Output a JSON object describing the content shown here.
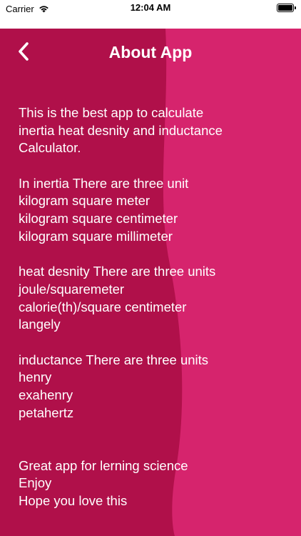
{
  "status_bar": {
    "carrier": "Carrier",
    "time": "12:04 AM"
  },
  "nav": {
    "title": "About App",
    "back_icon": "chevron-left-icon"
  },
  "colors": {
    "background": "#d6246d",
    "wave": "#b0104a",
    "text": "#ffffff"
  },
  "about": {
    "lines": [
      "This is the best app to calculate",
      "inertia heat desnity and inductance",
      "Calculator.",
      "",
      "In inertia There are three unit",
      "kilogram square meter",
      "kilogram square centimeter",
      "kilogram square millimeter",
      "",
      "heat desnity There are three units",
      "joule/squaremeter",
      "calorie(th)/square centimeter",
      "langely",
      "",
      "inductance There are three units",
      "henry",
      "exahenry",
      "petahertz",
      "",
      "",
      "Great app for lerning science",
      "Enjoy",
      "Hope you love this"
    ]
  }
}
